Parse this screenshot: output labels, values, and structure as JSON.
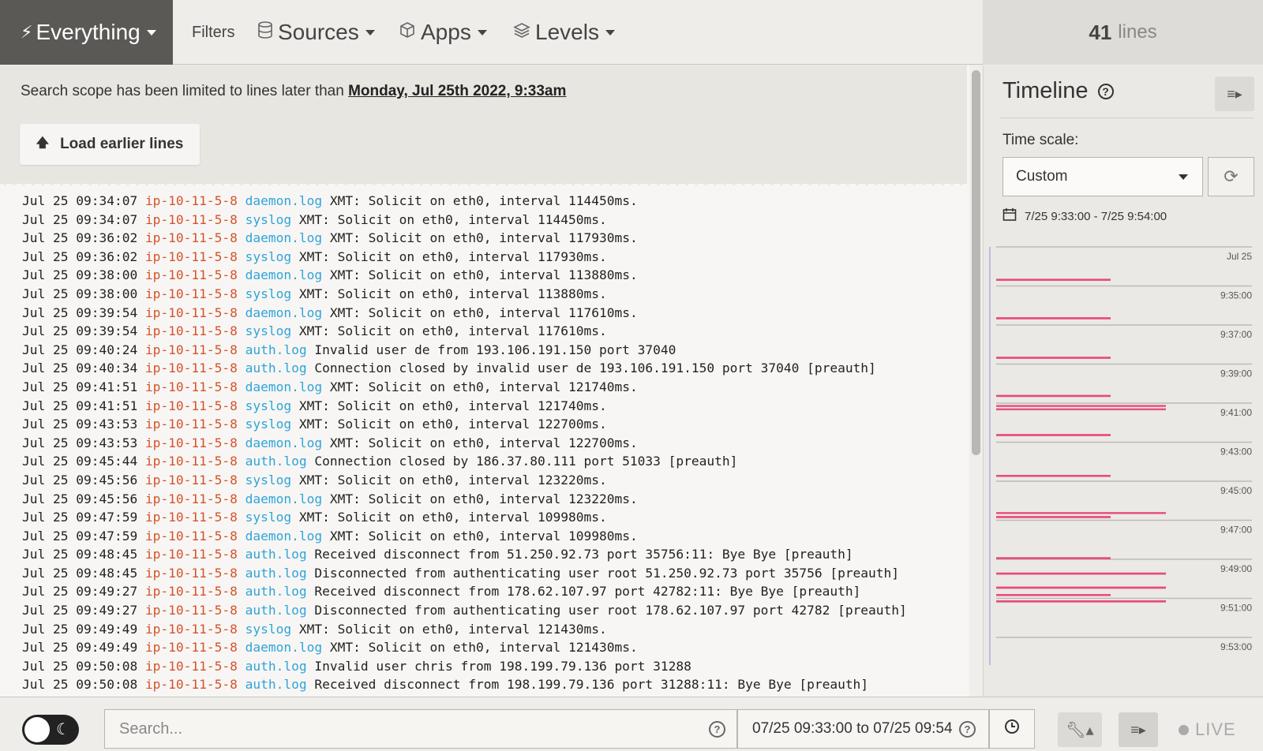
{
  "topbar": {
    "everything_label": "Everything",
    "filters_label": "Filters",
    "sources_label": "Sources",
    "apps_label": "Apps",
    "levels_label": "Levels"
  },
  "lines_count": {
    "number": "41",
    "label": "lines"
  },
  "scope": {
    "text": "Search scope has been limited to lines later than ",
    "date": "Monday, Jul 25th 2022, 9:33am",
    "load_button": "Load earlier lines"
  },
  "colors": {
    "host": "#d4532a",
    "source": "#2fa4d9",
    "timeline_bar": "#e8497a"
  },
  "log_lines": [
    {
      "ts": "Jul 25 09:34:07",
      "host": "ip-10-11-5-8",
      "src": "daemon.log",
      "msg": "XMT: Solicit on eth0, interval 114450ms."
    },
    {
      "ts": "Jul 25 09:34:07",
      "host": "ip-10-11-5-8",
      "src": "syslog",
      "msg": "XMT: Solicit on eth0, interval 114450ms."
    },
    {
      "ts": "Jul 25 09:36:02",
      "host": "ip-10-11-5-8",
      "src": "daemon.log",
      "msg": "XMT: Solicit on eth0, interval 117930ms."
    },
    {
      "ts": "Jul 25 09:36:02",
      "host": "ip-10-11-5-8",
      "src": "syslog",
      "msg": "XMT: Solicit on eth0, interval 117930ms."
    },
    {
      "ts": "Jul 25 09:38:00",
      "host": "ip-10-11-5-8",
      "src": "daemon.log",
      "msg": "XMT: Solicit on eth0, interval 113880ms."
    },
    {
      "ts": "Jul 25 09:38:00",
      "host": "ip-10-11-5-8",
      "src": "syslog",
      "msg": "XMT: Solicit on eth0, interval 113880ms."
    },
    {
      "ts": "Jul 25 09:39:54",
      "host": "ip-10-11-5-8",
      "src": "daemon.log",
      "msg": "XMT: Solicit on eth0, interval 117610ms."
    },
    {
      "ts": "Jul 25 09:39:54",
      "host": "ip-10-11-5-8",
      "src": "syslog",
      "msg": "XMT: Solicit on eth0, interval 117610ms."
    },
    {
      "ts": "Jul 25 09:40:24",
      "host": "ip-10-11-5-8",
      "src": "auth.log",
      "msg": "Invalid user de from 193.106.191.150 port 37040"
    },
    {
      "ts": "Jul 25 09:40:34",
      "host": "ip-10-11-5-8",
      "src": "auth.log",
      "msg": "Connection closed by invalid user de 193.106.191.150 port 37040 [preauth]"
    },
    {
      "ts": "Jul 25 09:41:51",
      "host": "ip-10-11-5-8",
      "src": "daemon.log",
      "msg": "XMT: Solicit on eth0, interval 121740ms."
    },
    {
      "ts": "Jul 25 09:41:51",
      "host": "ip-10-11-5-8",
      "src": "syslog",
      "msg": "XMT: Solicit on eth0, interval 121740ms."
    },
    {
      "ts": "Jul 25 09:43:53",
      "host": "ip-10-11-5-8",
      "src": "syslog",
      "msg": "XMT: Solicit on eth0, interval 122700ms."
    },
    {
      "ts": "Jul 25 09:43:53",
      "host": "ip-10-11-5-8",
      "src": "daemon.log",
      "msg": "XMT: Solicit on eth0, interval 122700ms."
    },
    {
      "ts": "Jul 25 09:45:44",
      "host": "ip-10-11-5-8",
      "src": "auth.log",
      "msg": "Connection closed by 186.37.80.111 port 51033 [preauth]"
    },
    {
      "ts": "Jul 25 09:45:56",
      "host": "ip-10-11-5-8",
      "src": "syslog",
      "msg": "XMT: Solicit on eth0, interval 123220ms."
    },
    {
      "ts": "Jul 25 09:45:56",
      "host": "ip-10-11-5-8",
      "src": "daemon.log",
      "msg": "XMT: Solicit on eth0, interval 123220ms."
    },
    {
      "ts": "Jul 25 09:47:59",
      "host": "ip-10-11-5-8",
      "src": "syslog",
      "msg": "XMT: Solicit on eth0, interval 109980ms."
    },
    {
      "ts": "Jul 25 09:47:59",
      "host": "ip-10-11-5-8",
      "src": "daemon.log",
      "msg": "XMT: Solicit on eth0, interval 109980ms."
    },
    {
      "ts": "Jul 25 09:48:45",
      "host": "ip-10-11-5-8",
      "src": "auth.log",
      "msg": "Received disconnect from 51.250.92.73 port 35756:11: Bye Bye [preauth]"
    },
    {
      "ts": "Jul 25 09:48:45",
      "host": "ip-10-11-5-8",
      "src": "auth.log",
      "msg": "Disconnected from authenticating user root 51.250.92.73 port 35756 [preauth]"
    },
    {
      "ts": "Jul 25 09:49:27",
      "host": "ip-10-11-5-8",
      "src": "auth.log",
      "msg": "Received disconnect from 178.62.107.97 port 42782:11: Bye Bye [preauth]"
    },
    {
      "ts": "Jul 25 09:49:27",
      "host": "ip-10-11-5-8",
      "src": "auth.log",
      "msg": "Disconnected from authenticating user root 178.62.107.97 port 42782 [preauth]"
    },
    {
      "ts": "Jul 25 09:49:49",
      "host": "ip-10-11-5-8",
      "src": "syslog",
      "msg": "XMT: Solicit on eth0, interval 121430ms."
    },
    {
      "ts": "Jul 25 09:49:49",
      "host": "ip-10-11-5-8",
      "src": "daemon.log",
      "msg": "XMT: Solicit on eth0, interval 121430ms."
    },
    {
      "ts": "Jul 25 09:50:08",
      "host": "ip-10-11-5-8",
      "src": "auth.log",
      "msg": "Invalid user chris from 198.199.79.136 port 31288"
    },
    {
      "ts": "Jul 25 09:50:08",
      "host": "ip-10-11-5-8",
      "src": "auth.log",
      "msg": "Received disconnect from 198.199.79.136 port 31288:11: Bye Bye [preauth]"
    }
  ],
  "timeline": {
    "title": "Timeline",
    "scale_label": "Time scale:",
    "scale_value": "Custom",
    "range_text": "7/25 9:33:00 - 7/25 9:54:00",
    "tick_labels": [
      "Jul 25",
      "9:35:00",
      "9:37:00",
      "9:39:00",
      "9:41:00",
      "9:43:00",
      "9:45:00",
      "9:47:00",
      "9:49:00",
      "9:51:00",
      "9:53:00"
    ]
  },
  "bottom": {
    "search_placeholder": "Search...",
    "date_range": "07/25 09:33:00 to 07/25 09:54",
    "live_label": "LIVE"
  }
}
